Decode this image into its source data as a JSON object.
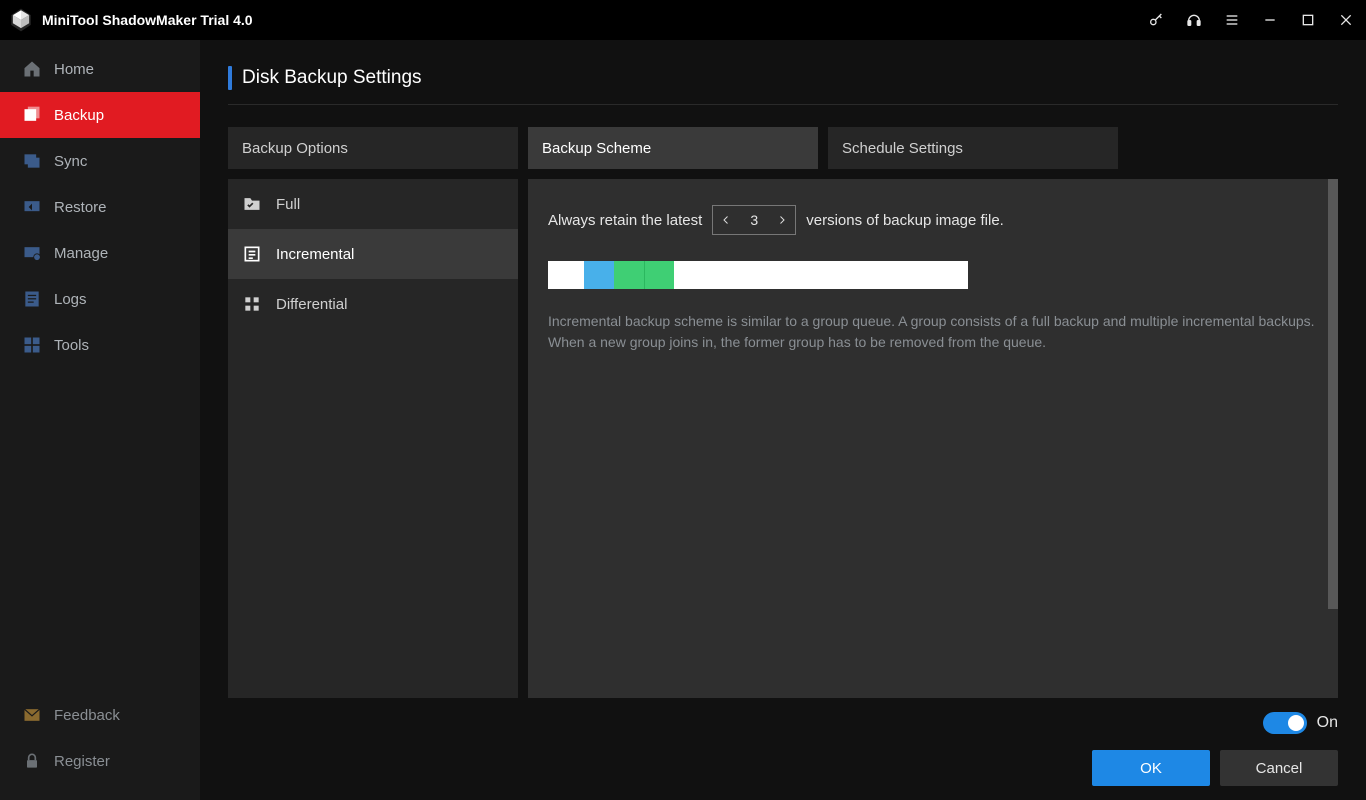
{
  "titlebar": {
    "title": "MiniTool ShadowMaker Trial 4.0"
  },
  "sidebar": {
    "items": [
      {
        "label": "Home"
      },
      {
        "label": "Backup"
      },
      {
        "label": "Sync"
      },
      {
        "label": "Restore"
      },
      {
        "label": "Manage"
      },
      {
        "label": "Logs"
      },
      {
        "label": "Tools"
      }
    ],
    "bottom": [
      {
        "label": "Feedback"
      },
      {
        "label": "Register"
      }
    ]
  },
  "page": {
    "title": "Disk Backup Settings"
  },
  "tabs": {
    "options": "Backup Options",
    "scheme": "Backup Scheme",
    "schedule": "Schedule Settings"
  },
  "schemes": {
    "full": "Full",
    "incremental": "Incremental",
    "differential": "Differential"
  },
  "retain": {
    "prefix": "Always retain the latest",
    "value": "3",
    "suffix": "versions of backup image file."
  },
  "description": "Incremental backup scheme is similar to a group queue. A group consists of a full backup and multiple incremental backups. When a new group joins in, the former group has to be removed from the queue.",
  "toggle": {
    "label": "On",
    "state": true
  },
  "buttons": {
    "ok": "OK",
    "cancel": "Cancel"
  },
  "colors": {
    "accent_red": "#e11b22",
    "accent_blue": "#1e88e5",
    "seg_blue": "#48b0ea",
    "seg_green": "#3fcf74"
  }
}
